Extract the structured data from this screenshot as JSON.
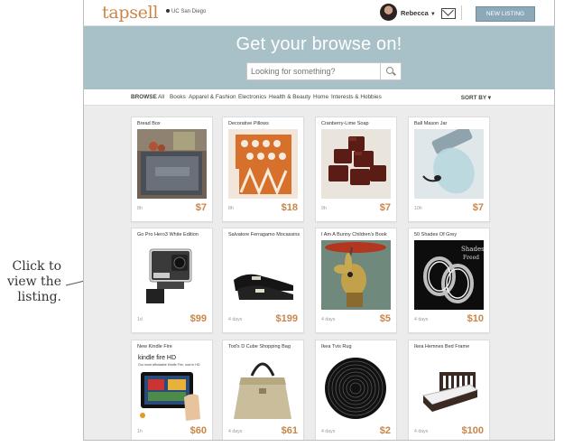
{
  "callout": {
    "lines": [
      "Click to",
      "view the",
      "listing."
    ]
  },
  "topbar": {
    "logo": "tapsell",
    "location": "UC San Diego",
    "user": "Rebecca",
    "new_listing_label": "NEW LISTING"
  },
  "hero": {
    "title": "Get your browse on!",
    "search_placeholder": "Looking for something?"
  },
  "catbar": {
    "browse_label": "BROWSE",
    "categories": [
      "All",
      "Books",
      "Apparel & Fashion",
      "Electronics",
      "Health & Beauty",
      "Home",
      "Interests & Hobbies"
    ],
    "sort_label": "SORT BY"
  },
  "listings": [
    {
      "title": "Bread Box",
      "time": "8h",
      "price": "$7"
    },
    {
      "title": "Decorative Pillows",
      "time": "8h",
      "price": "$18"
    },
    {
      "title": "Cranberry-Lime Soap",
      "time": "9h",
      "price": "$7"
    },
    {
      "title": "Ball Mason Jar",
      "time": "10h",
      "price": "$7"
    },
    {
      "title": "Go Pro Hero3 White Edition",
      "time": "1d",
      "price": "$99"
    },
    {
      "title": "Salvatore Ferragamo Mocassins",
      "time": "4 days",
      "price": "$199"
    },
    {
      "title": "I Am A Bunny Children's Book",
      "time": "4 days",
      "price": "$5"
    },
    {
      "title": "50 Shades Of Grey",
      "time": "4 days",
      "price": "$10"
    },
    {
      "title": "New Kindle Fire",
      "time": "1h",
      "price": "$60"
    },
    {
      "title": "Tod's D Cube Shopping Bag",
      "time": "4 days",
      "price": "$61"
    },
    {
      "title": "Ikea Tvis Rug",
      "time": "4 days",
      "price": "$2"
    },
    {
      "title": "Ikea Hemnes Bed Frame",
      "time": "4 days",
      "price": "$100"
    }
  ],
  "image_text": {
    "kindle_brand": "kindle fire HD",
    "kindle_tagline": "Our most affordable Kindle Fire, now in HD",
    "book_subtitle": "Shades",
    "book_subtitle2": "Freed"
  },
  "colors": {
    "accent": "#c9864a",
    "hero": "#a8c0c7",
    "button": "#8ba9b8"
  }
}
